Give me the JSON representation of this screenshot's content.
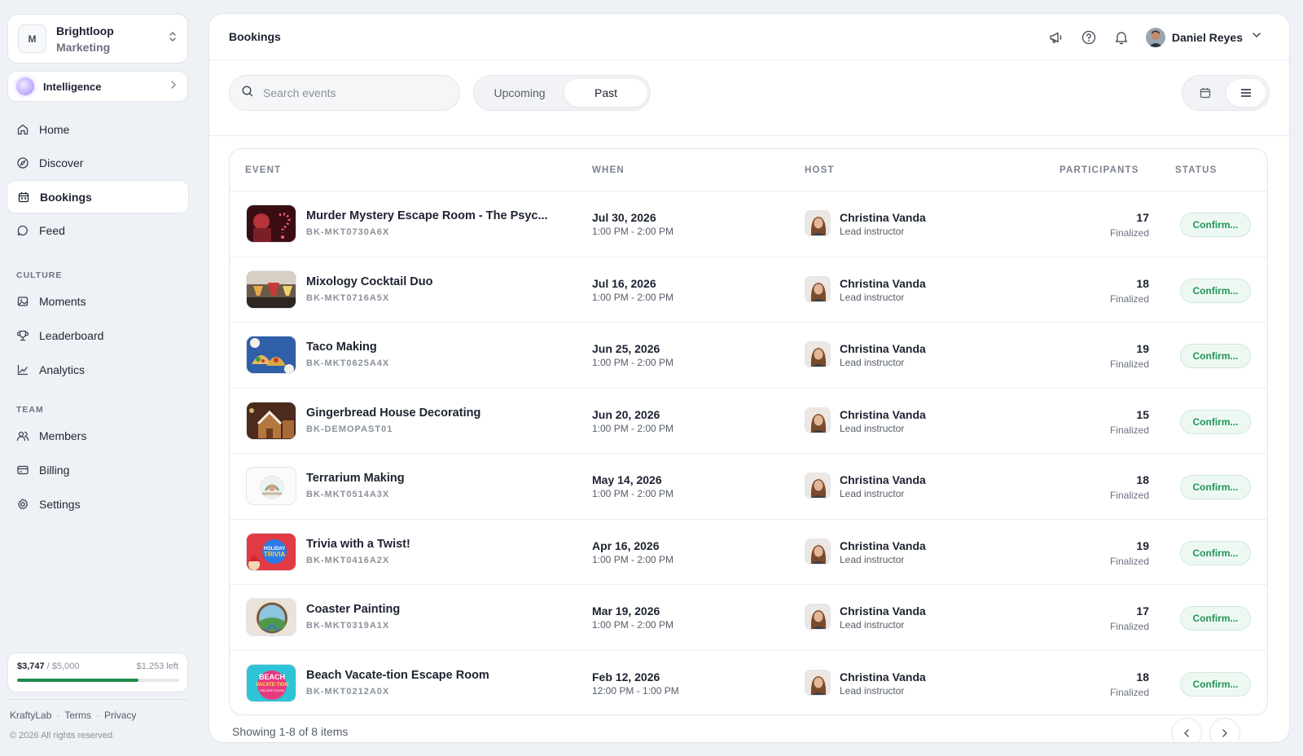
{
  "org": {
    "badge": "M",
    "name_line1": "Brightloop",
    "name_line2": "Marketing"
  },
  "intelligence": {
    "label": "Intelligence"
  },
  "nav": {
    "main": [
      {
        "label": "Home",
        "icon": "home-icon"
      },
      {
        "label": "Discover",
        "icon": "compass-icon"
      },
      {
        "label": "Bookings",
        "icon": "calendar-icon",
        "active": true
      },
      {
        "label": "Feed",
        "icon": "chat-bubble-icon"
      }
    ],
    "culture_heading": "CULTURE",
    "culture": [
      {
        "label": "Moments",
        "icon": "image-icon"
      },
      {
        "label": "Leaderboard",
        "icon": "trophy-icon"
      },
      {
        "label": "Analytics",
        "icon": "line-chart-icon"
      }
    ],
    "team_heading": "TEAM",
    "team": [
      {
        "label": "Members",
        "icon": "users-icon"
      },
      {
        "label": "Billing",
        "icon": "credit-card-icon"
      },
      {
        "label": "Settings",
        "icon": "gear-icon"
      }
    ]
  },
  "budget": {
    "spent": "$3,747",
    "total": " / $5,000",
    "left": "$1,253 left",
    "progress": 0.75,
    "color": "#1f8b4c"
  },
  "footer": {
    "brand": "KraftyLab",
    "terms": "Terms",
    "privacy": "Privacy",
    "sep1": "·",
    "sep2": "·",
    "copyright": "© 2026 All rights reserved."
  },
  "header": {
    "title": "Bookings",
    "user_name": "Daniel Reyes"
  },
  "toolbar": {
    "search_placeholder": "Search events",
    "tab_upcoming": "Upcoming",
    "tab_past": "Past",
    "selected_tab": "Past",
    "view_mode": "list"
  },
  "table": {
    "columns": {
      "event": "EVENT",
      "when": "WHEN",
      "host": "HOST",
      "participants": "PARTICIPANTS",
      "status": "STATUS"
    },
    "rows": [
      {
        "name": "Murder Mystery Escape Room - The Psyc...",
        "code": "BK-MKT0730A6X",
        "date": "Jul 30, 2026",
        "time": "1:00 PM - 2:00 PM",
        "host": "Christina Vanda",
        "host_role": "Lead instructor",
        "participants": "17",
        "participants_status": "Finalized",
        "status": "Confirm...",
        "thumb": "escape-room-thumb"
      },
      {
        "name": "Mixology Cocktail Duo",
        "code": "BK-MKT0716A5X",
        "date": "Jul 16, 2026",
        "time": "1:00 PM - 2:00 PM",
        "host": "Christina Vanda",
        "host_role": "Lead instructor",
        "participants": "18",
        "participants_status": "Finalized",
        "status": "Confirm...",
        "thumb": "cocktail-thumb"
      },
      {
        "name": "Taco Making",
        "code": "BK-MKT0625A4X",
        "date": "Jun 25, 2026",
        "time": "1:00 PM - 2:00 PM",
        "host": "Christina Vanda",
        "host_role": "Lead instructor",
        "participants": "19",
        "participants_status": "Finalized",
        "status": "Confirm...",
        "thumb": "taco-thumb"
      },
      {
        "name": "Gingerbread House Decorating",
        "code": "BK-DEMOPAST01",
        "date": "Jun 20, 2026",
        "time": "1:00 PM - 2:00 PM",
        "host": "Christina Vanda",
        "host_role": "Lead instructor",
        "participants": "15",
        "participants_status": "Finalized",
        "status": "Confirm...",
        "thumb": "gingerbread-thumb"
      },
      {
        "name": "Terrarium Making",
        "code": "BK-MKT0514A3X",
        "date": "May 14, 2026",
        "time": "1:00 PM - 2:00 PM",
        "host": "Christina Vanda",
        "host_role": "Lead instructor",
        "participants": "18",
        "participants_status": "Finalized",
        "status": "Confirm...",
        "thumb": "terrarium-thumb"
      },
      {
        "name": "Trivia with a Twist!",
        "code": "BK-MKT0416A2X",
        "date": "Apr 16, 2026",
        "time": "1:00 PM - 2:00 PM",
        "host": "Christina Vanda",
        "host_role": "Lead instructor",
        "participants": "19",
        "participants_status": "Finalized",
        "status": "Confirm...",
        "thumb": "trivia-thumb"
      },
      {
        "name": "Coaster Painting",
        "code": "BK-MKT0319A1X",
        "date": "Mar 19, 2026",
        "time": "1:00 PM - 2:00 PM",
        "host": "Christina Vanda",
        "host_role": "Lead instructor",
        "participants": "17",
        "participants_status": "Finalized",
        "status": "Confirm...",
        "thumb": "coaster-thumb"
      },
      {
        "name": "Beach Vacate-tion Escape Room",
        "code": "BK-MKT0212A0X",
        "date": "Feb 12, 2026",
        "time": "12:00 PM - 1:00 PM",
        "host": "Christina Vanda",
        "host_role": "Lead instructor",
        "participants": "18",
        "participants_status": "Finalized",
        "status": "Confirm...",
        "thumb": "beach-escape-thumb"
      }
    ]
  },
  "pagination": {
    "summary": "Showing 1-8 of 8 items"
  },
  "colors": {
    "accent_green": "#22945a",
    "status_bg": "#eef8f2",
    "page_bg": "#eef1f5"
  }
}
